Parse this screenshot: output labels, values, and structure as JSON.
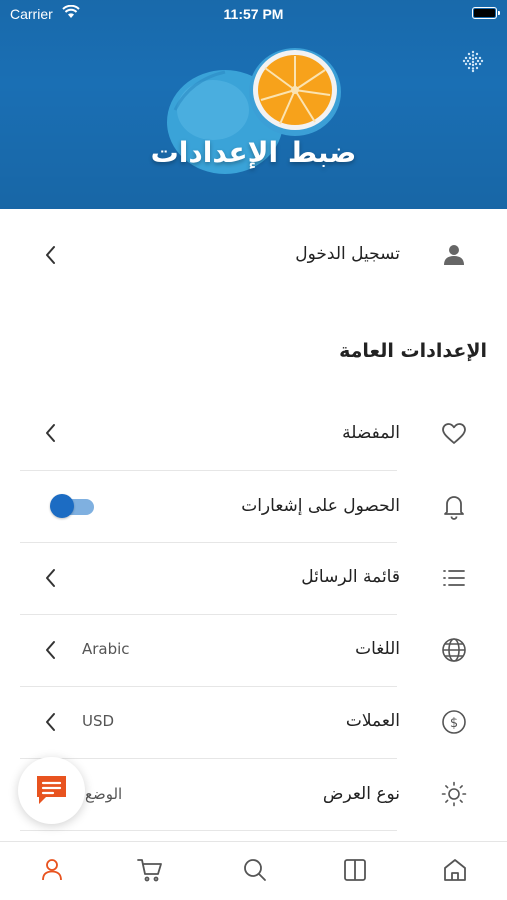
{
  "status_bar": {
    "carrier": "Carrier",
    "time": "11:57 PM"
  },
  "header": {
    "title": "ضبط الإعدادات"
  },
  "login": {
    "label": "تسجيل الدخول"
  },
  "general": {
    "title": "الإعدادات العامة",
    "items": [
      {
        "label": "المفضلة",
        "icon": "heart-icon"
      },
      {
        "label": "الحصول على إشعارات",
        "icon": "bell-icon",
        "toggle_on": true
      },
      {
        "label": "قائمة الرسائل",
        "icon": "list-icon"
      },
      {
        "label": "اللغات",
        "icon": "globe-icon",
        "value": "Arabic"
      },
      {
        "label": "العملات",
        "icon": "dollar-icon",
        "value": "USD"
      },
      {
        "label": "نوع العرض",
        "icon": "sun-icon",
        "value": "الوضع"
      }
    ]
  },
  "tabbar": {
    "tabs": [
      {
        "icon": "user-icon",
        "active": true
      },
      {
        "icon": "cart-icon",
        "active": false
      },
      {
        "icon": "search-icon",
        "active": false
      },
      {
        "icon": "book-icon",
        "active": false
      },
      {
        "icon": "home-icon",
        "active": false
      }
    ]
  },
  "colors": {
    "hero_blue": "#1a6fb4",
    "accent_orange": "#e8531f",
    "toggle_blue": "#1c6cc3",
    "icon_gray": "#555555"
  }
}
